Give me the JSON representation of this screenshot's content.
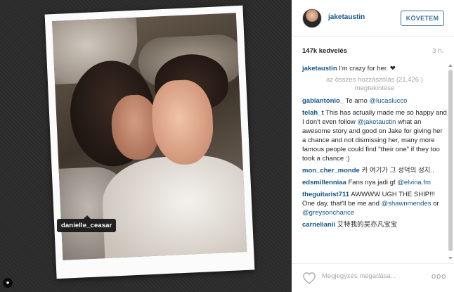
{
  "photo": {
    "tag_label": "danielle_ceasar"
  },
  "post": {
    "author": "jaketaustin",
    "follow_label": "KÖVETEM",
    "likes": "147k kedvelés",
    "age": "3 h."
  },
  "caption": {
    "user": "jaketaustin",
    "text": "I'm crazy for her. ❤"
  },
  "view_all_label": "az összes hozzászólás (21,426 ) megtekintése",
  "comments": [
    {
      "user": "gabiantonio_",
      "parts": [
        {
          "t": "Te amo "
        },
        {
          "m": "@lucaslucco"
        }
      ]
    },
    {
      "user": "telah_t",
      "parts": [
        {
          "t": "This has actually made me so happy and I don't even follow "
        },
        {
          "m": "@jaketaustin"
        },
        {
          "t": " what an awesome story and good on Jake for giving her a chance and not dismissing her, many more famous people could find \"their one\" if they too took a chance :)"
        }
      ]
    },
    {
      "user": "mon_cher_monde",
      "parts": [
        {
          "t": "카 여기가 그 성덕의 성지.."
        }
      ]
    },
    {
      "user": "edsmillenniaa",
      "parts": [
        {
          "t": "Fans nya jadi gf "
        },
        {
          "m": "@elvina.fm"
        }
      ]
    },
    {
      "user": "theguitarist711",
      "parts": [
        {
          "t": "AWWWW UGH THE SHIP!!! One day, that'll be me and "
        },
        {
          "m": "@shawnmendes"
        },
        {
          "t": " or "
        },
        {
          "m": "@greysonchance"
        }
      ]
    },
    {
      "user": "carnelianii",
      "parts": [
        {
          "t": "艾特我的吴亦凡宝宝"
        }
      ]
    }
  ],
  "footer": {
    "placeholder": "Megjegyzés megadása...",
    "more_label": "ooo"
  },
  "icons": {
    "like": "heart-icon",
    "more": "ellipsis-icon",
    "tag": "user-tag-icon"
  }
}
